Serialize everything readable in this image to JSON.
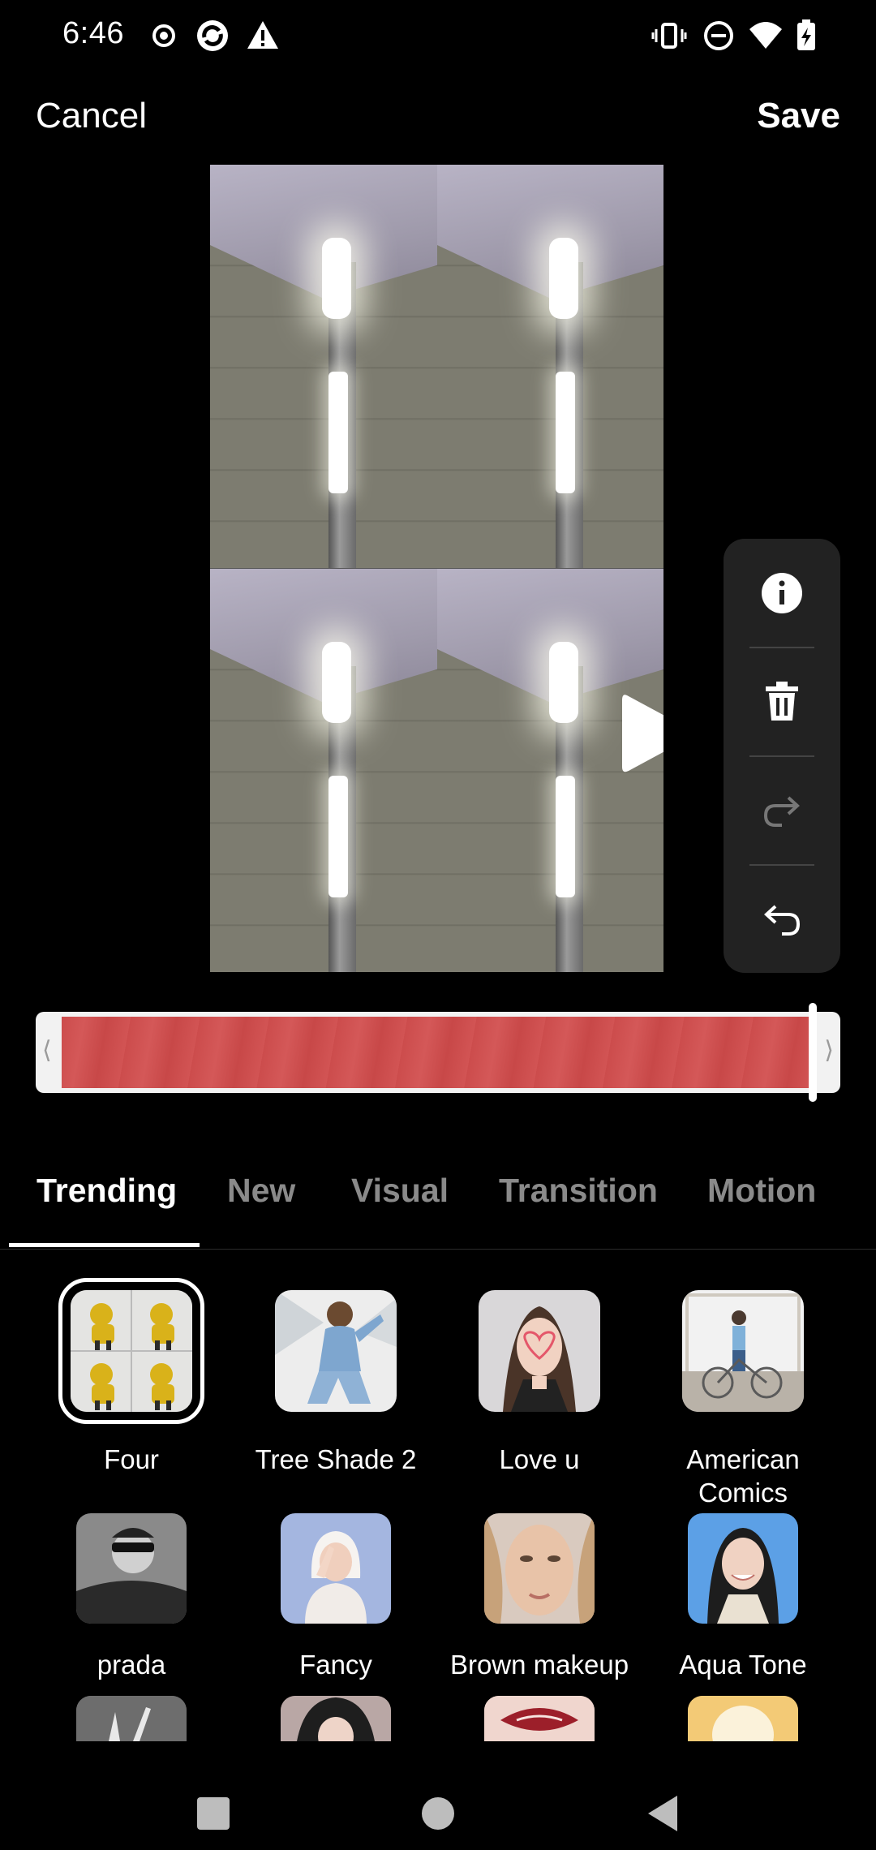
{
  "status_bar": {
    "time": "6:46",
    "left_icons": [
      "record-icon",
      "sync-icon",
      "warning-icon"
    ],
    "right_icons": [
      "vibrate-icon",
      "do-not-disturb-icon",
      "wifi-icon",
      "battery-charging-icon"
    ]
  },
  "top_bar": {
    "cancel_label": "Cancel",
    "save_label": "Save"
  },
  "preview": {
    "play_icon": "play-icon"
  },
  "side_toolbar": {
    "items": [
      {
        "icon": "info-icon",
        "enabled": true
      },
      {
        "icon": "trash-icon",
        "enabled": true
      },
      {
        "icon": "redo-icon",
        "enabled": false
      },
      {
        "icon": "undo-icon",
        "enabled": true
      }
    ]
  },
  "timeline": {
    "left_handle": "⟨",
    "right_handle": "⟩",
    "track_color": "#cc4c4c"
  },
  "tabs": [
    {
      "label": "Trending",
      "active": true
    },
    {
      "label": "New",
      "active": false
    },
    {
      "label": "Visual",
      "active": false
    },
    {
      "label": "Transition",
      "active": false
    },
    {
      "label": "Motion",
      "active": false
    }
  ],
  "effects": [
    {
      "label": "Four",
      "selected": true
    },
    {
      "label": "Tree Shade 2",
      "selected": false
    },
    {
      "label": "Love u",
      "selected": false
    },
    {
      "label": "American\nComics",
      "selected": false
    },
    {
      "label": "prada",
      "selected": false
    },
    {
      "label": "Fancy",
      "selected": false
    },
    {
      "label": "Brown makeup",
      "selected": false
    },
    {
      "label": "Aqua Tone",
      "selected": false
    }
  ],
  "nav_bar": {
    "icons": [
      "recents-square-icon",
      "home-circle-icon",
      "back-triangle-icon"
    ]
  },
  "colors": {
    "background": "#000000",
    "tab_inactive": "#8a8a8a",
    "toolbar_bg": "#222222",
    "accent_white": "#ffffff"
  }
}
